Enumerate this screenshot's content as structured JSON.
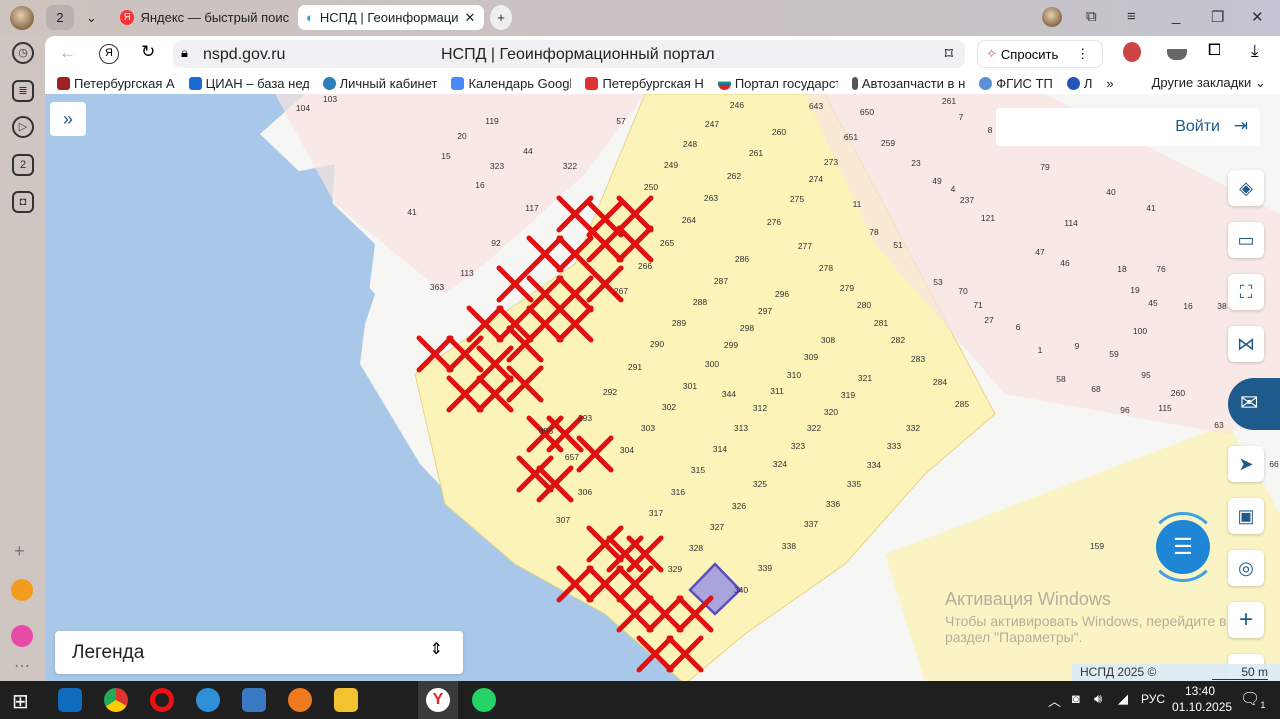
{
  "browser": {
    "tab_count": "2",
    "tabs": [
      {
        "label": "Яндекс — быстрый поиск"
      },
      {
        "label": "НСПД | Геоинформаци"
      }
    ],
    "url": "nspd.gov.ru",
    "page_title": "НСПД | Геоинформационный портал",
    "ask_label": "Спросить",
    "bookmarks": [
      "Петербургская А",
      "ЦИАН – база нед",
      "Личный кабинет",
      "Календарь Google",
      "Петербургская Н",
      "Портал государст",
      "Автозапчасти в н",
      "ФГИС ТП",
      "Л"
    ],
    "other_bookmarks": "Другие закладки",
    "more": "»"
  },
  "map": {
    "login_label": "Войти",
    "legend_label": "Легенда",
    "copyright": "НСПД 2025 ©",
    "scale": "50 m",
    "parcels_yellow": [
      "246",
      "247",
      "248",
      "260",
      "261",
      "249",
      "262",
      "250",
      "263",
      "273",
      "274",
      "275",
      "264",
      "276",
      "265",
      "277",
      "286",
      "266",
      "278",
      "287",
      "279",
      "267",
      "296",
      "288",
      "280",
      "297",
      "289",
      "281",
      "298",
      "308",
      "282",
      "290",
      "299",
      "309",
      "283",
      "300",
      "291",
      "310",
      "321",
      "284",
      "301",
      "344",
      "311",
      "319",
      "292",
      "312",
      "285",
      "302",
      "320",
      "293",
      "313",
      "322",
      "332",
      "303",
      "314",
      "323",
      "333",
      "304",
      "324",
      "334",
      "315",
      "325",
      "335",
      "316",
      "336",
      "326",
      "317",
      "337",
      "327",
      "338",
      "328",
      "339",
      "329",
      "340",
      "656",
      "657",
      "306",
      "307"
    ],
    "parcels_pink": [
      "103",
      "104",
      "119",
      "57",
      "20",
      "44",
      "15",
      "323",
      "322",
      "16",
      "117",
      "41",
      "92",
      "113",
      "363",
      "643",
      "650",
      "651",
      "259",
      "261",
      "7",
      "8",
      "23",
      "49",
      "4",
      "237",
      "121",
      "11",
      "78",
      "51",
      "79",
      "40",
      "41",
      "114",
      "47",
      "46",
      "18",
      "76",
      "19",
      "45",
      "16",
      "38",
      "53",
      "70",
      "71",
      "27",
      "6",
      "100",
      "1",
      "9",
      "59",
      "95",
      "58",
      "68",
      "260",
      "96",
      "115",
      "63",
      "159",
      "66"
    ],
    "selected_parcel": "340"
  },
  "watermark": {
    "title": "Активация Windows",
    "line1": "Чтобы активировать Windows, перейдите в",
    "line2": "раздел \"Параметры\"."
  },
  "taskbar": {
    "lang": "РУС",
    "time": "13:40",
    "date": "01.10.2025",
    "notifications": "1"
  }
}
